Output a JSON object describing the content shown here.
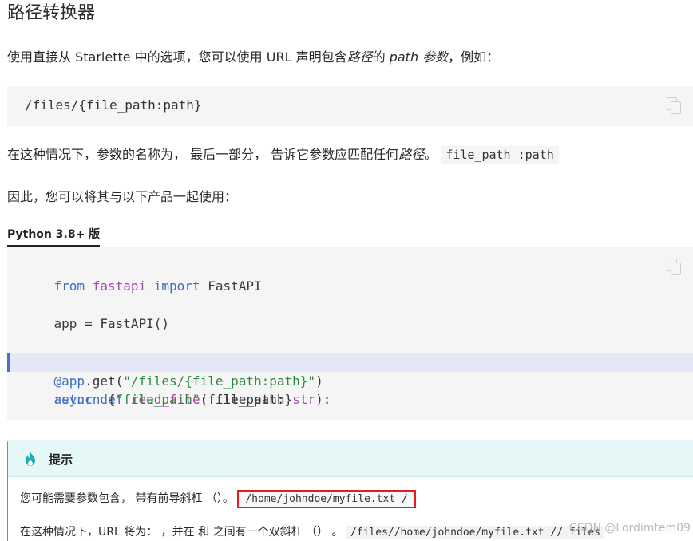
{
  "heading": "路径转换器",
  "intro": {
    "part1": "使用直接从 Starlette 中的选项，您可以使用 URL 声明包含",
    "em1": "路径",
    "part2": "的 ",
    "em2": "path 参数",
    "part3": "，例如："
  },
  "code_block_1": {
    "code": "/files/{file_path:path}",
    "copy_icon": "copy-icon"
  },
  "para2": {
    "part1": "在这种情况下，参数的名称为， 最后一部分， 告诉它参数应匹配任何",
    "em": "路径",
    "part2": "。",
    "code": "file_path :path"
  },
  "para3": "因此，您可以将其与以下产品一起使用：",
  "tab": {
    "label": "Python 3.8+ 版"
  },
  "code_block_2": {
    "line1": {
      "kw1": "from",
      "mod": "fastapi",
      "kw2": "import",
      "cls": "FastAPI"
    },
    "line2": {
      "var": "app",
      "op": " = ",
      "call": "FastAPI()"
    },
    "line3": {
      "deco": "@app",
      "method": ".get(",
      "str": "\"/files/{file_path:path}\"",
      "close": ")"
    },
    "line4": {
      "kw1": "async",
      "kw2": "def",
      "fn": "read_file",
      "open": "(file_path: ",
      "typ": "str",
      "close": "):"
    },
    "line5": {
      "kw": "return",
      "open": " {",
      "str": "\"file_path\"",
      "rest": ": file_path}"
    },
    "copy_icon": "copy-icon"
  },
  "admonition": {
    "icon": "flame-icon",
    "title": "提示",
    "line1_text": "您可能需要参数包含， 带有前导斜杠 （）。",
    "line1_code": "/home/johndoe/myfile.txt /",
    "line2_text": "在这种情况下，URL 将为： ，并在 和 之间有一个双斜杠 （） 。",
    "line2_code": "/files//home/johndoe/myfile.txt // files"
  },
  "watermark": "CSDN @Lordimtem09",
  "colors": {
    "keyword": "#3f6ec6",
    "module": "#a846b9",
    "string": "#2b8a3e",
    "admonition_border": "#18b7b7",
    "highlight_bar": "#4a6fd1",
    "red_box": "#e02020"
  }
}
